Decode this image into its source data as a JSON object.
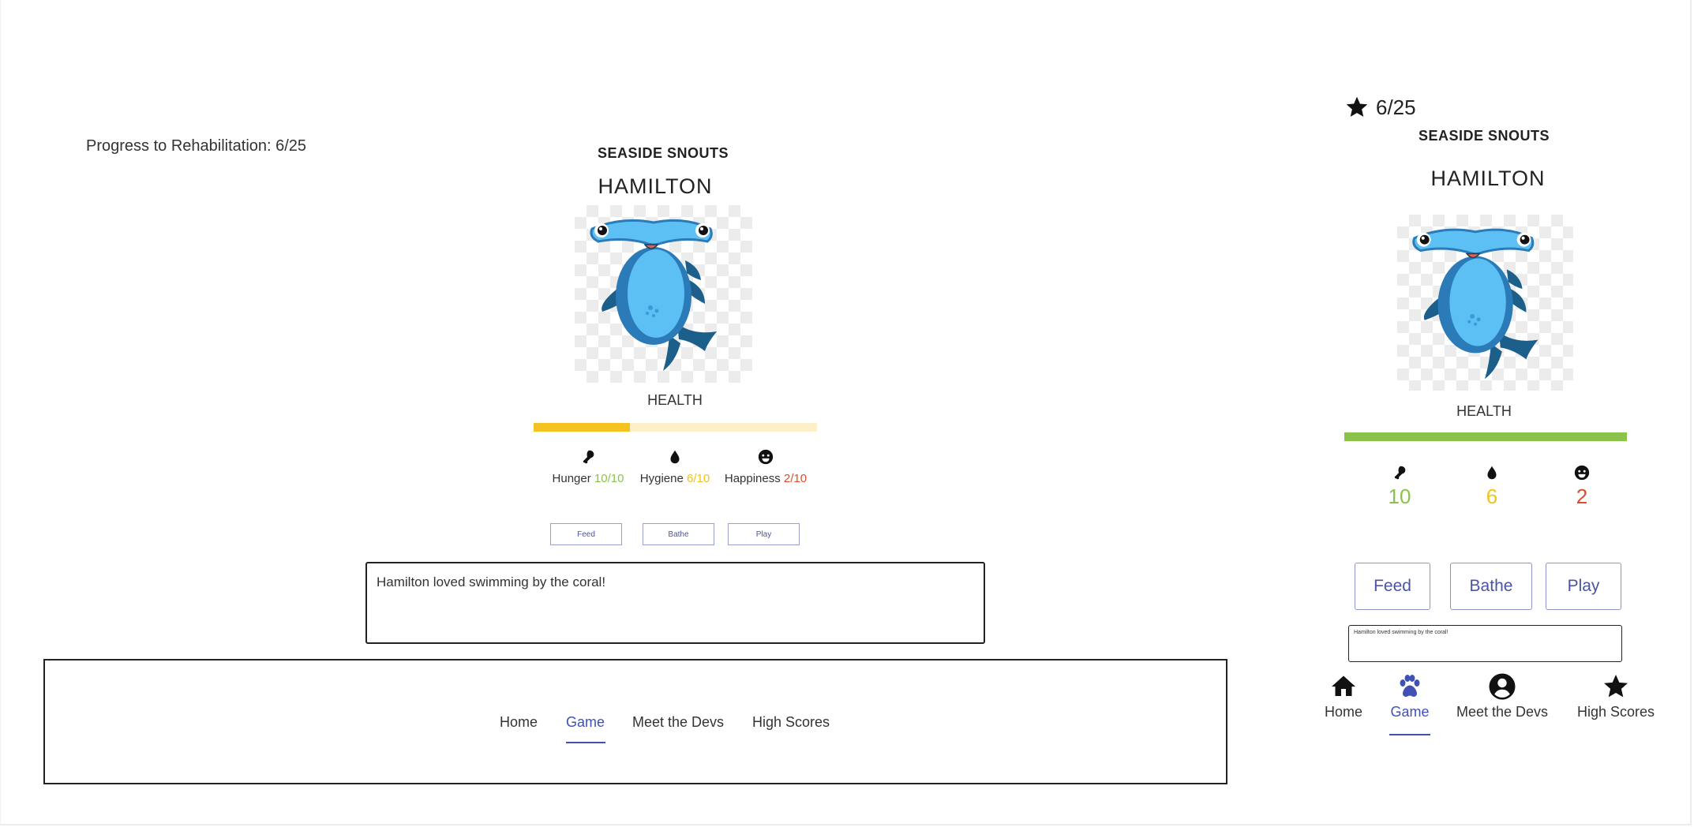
{
  "app": {
    "brand": "SEASIDE SNOUTS",
    "pet_name": "HAMILTON",
    "progress_label": "Progress to Rehabilitation: 6/25",
    "score_text": "6/25",
    "progress_value": 6,
    "progress_max": 25
  },
  "health": {
    "label": "HEALTH",
    "desktop_fraction": 0.34,
    "mobile_fraction": 1.0,
    "desktop_color": "#f4c321",
    "mobile_color": "#8bc34a"
  },
  "stats": [
    {
      "label": "Hunger",
      "value": "10/10",
      "number": "10",
      "icon": "drumstick-icon",
      "color": "#8bc34a"
    },
    {
      "label": "Hygiene",
      "value": "6/10",
      "number": "6",
      "icon": "water-drop-icon",
      "color": "#f0c419"
    },
    {
      "label": "Happiness",
      "value": "2/10",
      "number": "2",
      "icon": "smiley-icon",
      "color": "#e04b2b"
    }
  ],
  "actions": {
    "feed": "Feed",
    "bathe": "Bathe",
    "play": "Play"
  },
  "message": "Hamilton loved swimming by the coral!",
  "nav": {
    "items": [
      {
        "label": "Home",
        "icon": "home-icon"
      },
      {
        "label": "Game",
        "icon": "paw-icon"
      },
      {
        "label": "Meet the Devs",
        "icon": "account-circle-icon"
      },
      {
        "label": "High Scores",
        "icon": "star-icon"
      }
    ],
    "active": "Game"
  },
  "colors": {
    "accent": "#3f51b5",
    "good": "#8bc34a",
    "warn": "#f0c419",
    "bad": "#e04b2b"
  }
}
